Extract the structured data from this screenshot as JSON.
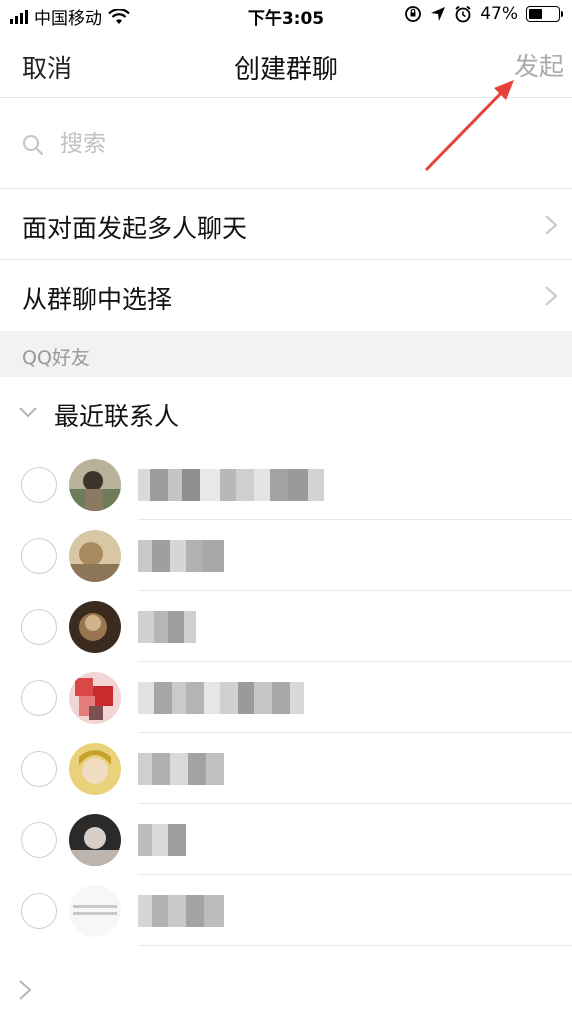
{
  "status_bar": {
    "carrier": "中国移动",
    "time": "下午3:05",
    "battery_percent": "47%",
    "battery_level": 0.47,
    "icons": [
      "signal-icon",
      "wifi-icon",
      "orientation-lock-icon",
      "location-icon",
      "alarm-icon",
      "battery-icon"
    ]
  },
  "nav": {
    "cancel_label": "取消",
    "title": "创建群聊",
    "launch_label": "发起"
  },
  "search": {
    "placeholder": "搜索"
  },
  "menu": {
    "face_to_face": "面对面发起多人聊天",
    "from_group": "从群聊中选择"
  },
  "section": {
    "title": "QQ好友"
  },
  "group": {
    "label": "最近联系人"
  },
  "contacts": [
    {
      "avatar": "avatar-photo-1"
    },
    {
      "avatar": "avatar-photo-2"
    },
    {
      "avatar": "avatar-photo-3"
    },
    {
      "avatar": "avatar-photo-4"
    },
    {
      "avatar": "avatar-photo-5"
    },
    {
      "avatar": "avatar-photo-6"
    },
    {
      "avatar": "avatar-photo-7"
    }
  ],
  "colors": {
    "launch_disabled": "#aaaaaa",
    "section_bg": "#f2f2f4",
    "annotation_arrow": "#e8403a"
  }
}
